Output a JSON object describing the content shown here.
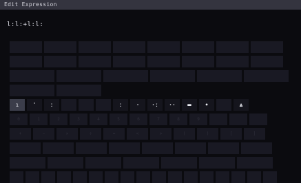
{
  "window": {
    "title": "Edit Expression"
  },
  "expression": {
    "text": "l:l:+l:l:"
  },
  "rows": [
    {
      "name": "var-row-1",
      "keys": [
        "a1",
        "a2",
        "a3",
        "a4",
        "a5",
        "a6",
        "a7",
        "a8"
      ]
    },
    {
      "name": "var-row-2",
      "keys": [
        "b1",
        "b2",
        "b3",
        "b4",
        "b5",
        "b6",
        "b7",
        "b8"
      ]
    },
    {
      "name": "var-row-3",
      "keys": [
        "c1",
        "c2",
        "c3",
        "c4",
        "c5",
        "c6",
        "c7"
      ]
    },
    {
      "name": "var-row-4",
      "keys": [
        "d1",
        "d2"
      ]
    },
    {
      "name": "syllable-row",
      "keys": [
        "ı",
        "ˈ",
        "ː",
        "",
        "",
        " ",
        "ː",
        "·",
        "·ː",
        "··",
        "▬",
        "•",
        "",
        "⩓"
      ]
    },
    {
      "name": "digit-row",
      "keys": [
        "0",
        "1",
        "2",
        "3",
        "4",
        "5",
        "6",
        "7",
        "8",
        "9",
        "",
        "",
        ""
      ]
    },
    {
      "name": "op-row-1",
      "keys": [
        "+",
        "−",
        "×",
        "÷",
        "=",
        "<",
        ">",
        "(",
        ")",
        "[",
        "]"
      ]
    },
    {
      "name": "op-row-2",
      "keys": [
        "e1",
        "e2",
        "e3",
        "e4",
        "e5",
        "e6",
        "e7",
        "e8"
      ]
    },
    {
      "name": "op-row-3",
      "keys": [
        "f1",
        "f2",
        "f3",
        "f4",
        "f5",
        "f6",
        "f7"
      ]
    },
    {
      "name": "op-row-4",
      "keys": [
        "g1",
        "g2",
        "g3",
        "g4",
        "g5",
        "g6",
        "g7",
        "g8",
        "g9",
        "g10",
        "g11",
        "g12",
        "g13",
        "g14",
        "g15",
        "g16",
        "g17"
      ]
    }
  ]
}
